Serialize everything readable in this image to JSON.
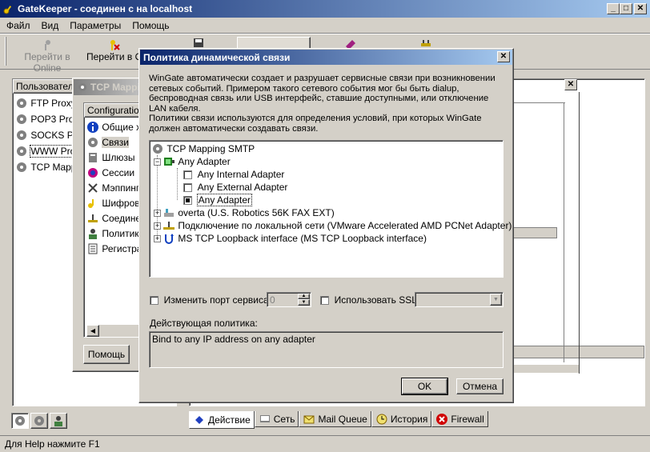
{
  "app": {
    "title": "GateKeeper - соединен с на localhost",
    "menu": [
      "Файл",
      "Вид",
      "Параметры",
      "Помощь"
    ],
    "toolbar": {
      "online": "Перейти в Online",
      "offline": "Перейти в O"
    },
    "services_header": "Пользовател",
    "services": [
      "FTP Proxy",
      "POP3 Prox",
      "SOCKS Pro",
      "WWW Prox",
      "TCP Mapp"
    ],
    "tabs": [
      "Действие",
      "Сеть",
      "Mail Queue",
      "История",
      "Firewall"
    ],
    "status": "Для Help нажмите F1"
  },
  "mid_dialog": {
    "title": "TCP Mapping",
    "config_header": "Configuration",
    "items": [
      "Общие х",
      "Связи",
      "Шлюзы",
      "Сессии",
      "Мэппинг",
      "Шифров",
      "Соедине",
      "Политик",
      "Регистра"
    ],
    "help_button": "Помощь"
  },
  "dialog": {
    "title": "Политика динамической связи",
    "desc1": "WinGate автоматически создает и разрушает сервисные связи при возникновении сетевых событий. Примером такого сетевого события мог бы быть dialup, беспроводная связь или USB интерфейс, ставшие доступными, или отключение LAN кабеля.",
    "desc2": "Политики связи используются для определения условий, при которых WinGate должен автоматически создавать связи.",
    "tree": {
      "root": "TCP Mapping SMTP",
      "any_adapter": "Any Adapter",
      "children": [
        {
          "label": "Any Internal Adapter",
          "checked": false
        },
        {
          "label": "Any External Adapter",
          "checked": false
        },
        {
          "label": "Any Adapter",
          "checked": true
        }
      ],
      "others": [
        "overta (U.S. Robotics 56K FAX EXT)",
        "Подключение по локальной сети (VMware Accelerated AMD PCNet Adapter)",
        "MS TCP Loopback interface (MS TCP Loopback interface)"
      ]
    },
    "change_port_label": "Изменить порт сервиса:",
    "port_value": "0",
    "use_ssl_label": "Использовать SSL",
    "policy_label": "Действующая политика:",
    "policy_text": "Bind to any IP address on any adapter",
    "ok": "OK",
    "cancel": "Отмена"
  }
}
